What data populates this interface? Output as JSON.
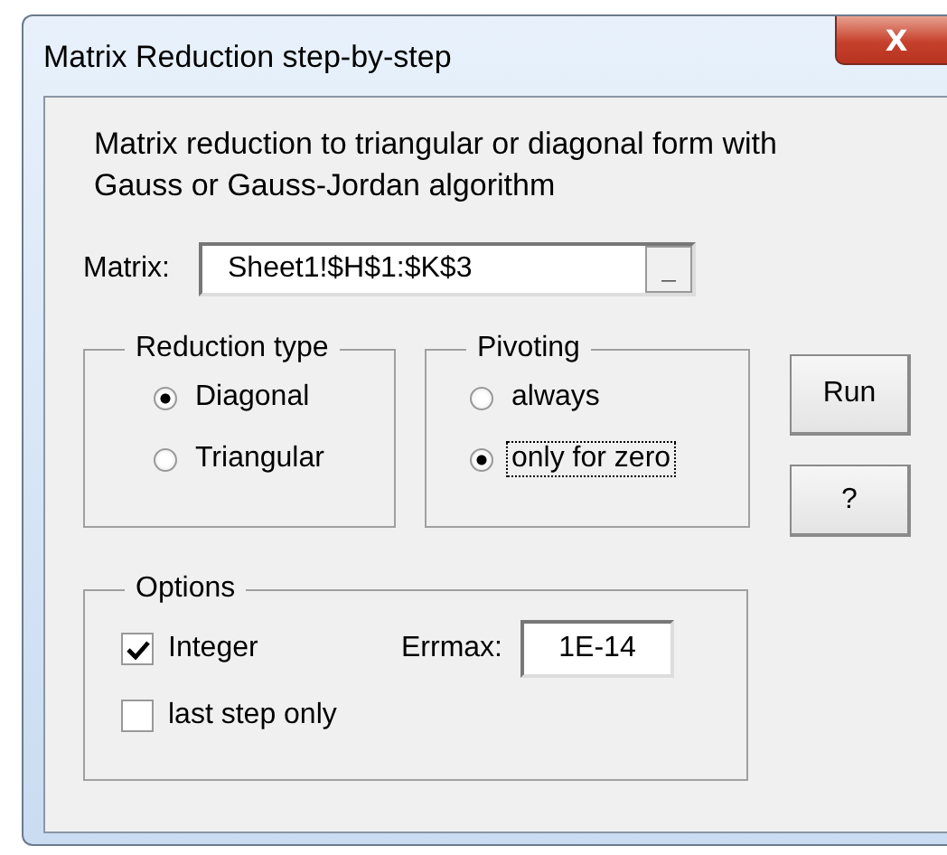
{
  "window": {
    "title": "Matrix Reduction step-by-step",
    "close": "X"
  },
  "description": "Matrix reduction to triangular or diagonal form with Gauss or Gauss-Jordan algorithm",
  "matrix": {
    "label": "Matrix:",
    "value": "Sheet1!$H$1:$K$3",
    "button": "_"
  },
  "reduction_type": {
    "title": "Reduction type",
    "options": [
      {
        "label": "Diagonal",
        "selected": true
      },
      {
        "label": "Triangular",
        "selected": false
      }
    ]
  },
  "pivoting": {
    "title": "Pivoting",
    "options": [
      {
        "label": "always",
        "selected": false,
        "focused": false
      },
      {
        "label": "only for zero",
        "selected": true,
        "focused": true
      }
    ]
  },
  "buttons": [
    "Run",
    "?"
  ],
  "options": {
    "title": "Options",
    "checkboxes": [
      {
        "label": "Integer",
        "checked": true
      },
      {
        "label": "last step only",
        "checked": false
      }
    ],
    "errmax": {
      "label": "Errmax:",
      "value": "1E-14"
    }
  }
}
